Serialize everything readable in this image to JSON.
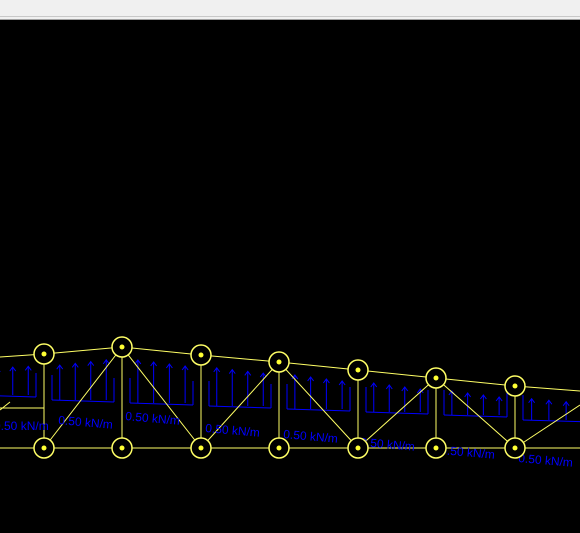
{
  "colors": {
    "background": "#000000",
    "member": "#ffff66",
    "node_ring": "#ffff66",
    "node_dot": "#ffff33",
    "load": "#0000ff",
    "window_bar": "#f0f0f0"
  },
  "icons": {
    "node": "circle-node-icon",
    "load_arrow": "up-arrow-icon"
  },
  "load_label_text": "0.50 kN/m"
}
